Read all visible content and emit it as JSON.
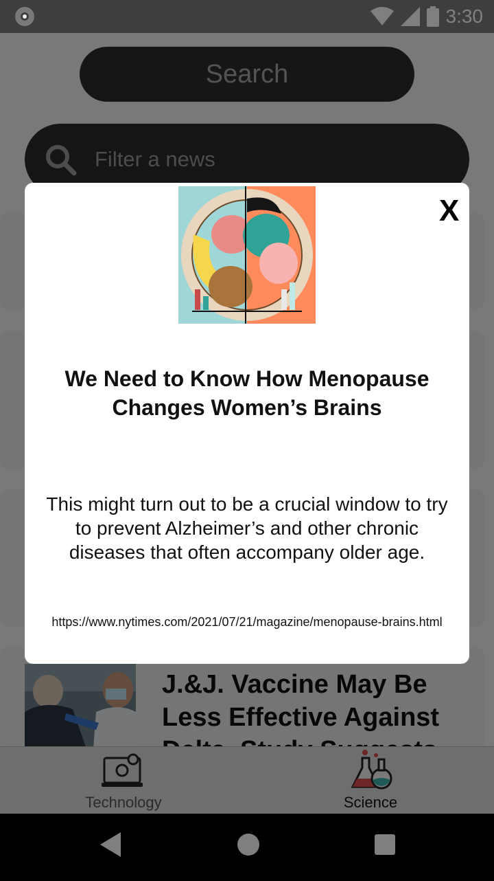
{
  "status_bar": {
    "time": "3:30"
  },
  "header": {
    "search_title": "Search"
  },
  "filter": {
    "placeholder": "Filter a news"
  },
  "news": [
    {
      "title": "J.&J. Vaccine May Be Less Effective Against Delta, Study Suggests"
    }
  ],
  "bottom_nav": {
    "items": [
      {
        "label": "Technology",
        "icon": "technology-icon",
        "active": false
      },
      {
        "label": "Science",
        "icon": "science-icon",
        "active": true
      }
    ]
  },
  "modal": {
    "close_label": "X",
    "title": "We Need to Know How Menopause Changes Women’s Brains",
    "description": "This might turn out to be a crucial window to try to prevent Alzheimer’s and other chronic diseases that often accompany older age.",
    "url": "https://www.nytimes.com/2021/07/21/magazine/menopause-brains.html"
  },
  "colors": {
    "accent_teal": "#9fd6d8",
    "accent_orange": "#ff8a5b"
  }
}
